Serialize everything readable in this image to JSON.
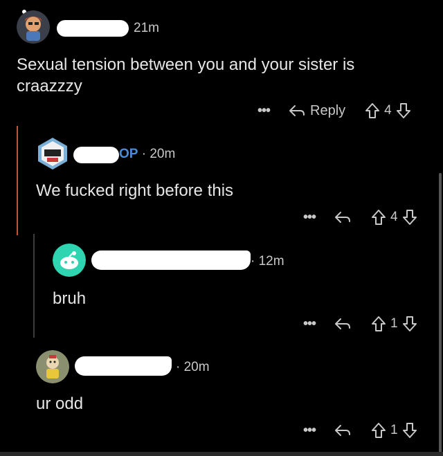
{
  "comments": [
    {
      "time": "21m",
      "text_line1": "Sexual tension between you and your sister is",
      "text_line2": "craazzzy",
      "more": "•••",
      "reply_label": "Reply",
      "votes": "4"
    },
    {
      "op_tag": "OP",
      "separator": "·",
      "time": "20m",
      "text": "We fucked right before this",
      "more": "•••",
      "votes": "4"
    },
    {
      "separator": "·",
      "time": "12m",
      "text": "bruh",
      "more": "•••",
      "votes": "1"
    },
    {
      "separator": "·",
      "time": "20m",
      "text": "ur odd",
      "more": "•••",
      "votes": "1"
    }
  ]
}
